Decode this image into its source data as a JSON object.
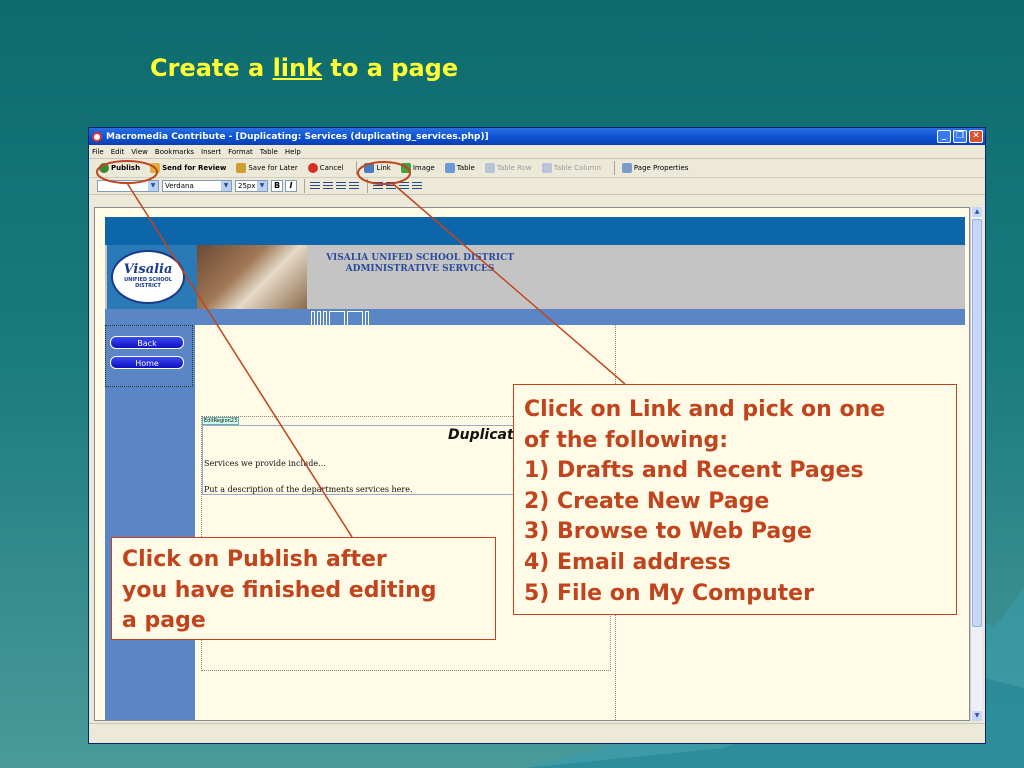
{
  "slide": {
    "title_prefix": "Create a ",
    "title_link": "link",
    "title_suffix": " to a page"
  },
  "window": {
    "title": "Macromedia Contribute - [Duplicating: Services (duplicating_services.php)]",
    "minimize": "_",
    "maximize": "❐",
    "close": "✕",
    "menu": [
      "File",
      "Edit",
      "View",
      "Bookmarks",
      "Insert",
      "Format",
      "Table",
      "Help"
    ]
  },
  "toolbar": {
    "publish": "Publish",
    "send_for_review": "Send for Review",
    "save_for_later": "Save for Later",
    "cancel": "Cancel",
    "link": "Link",
    "image": "Image",
    "table": "Table",
    "table_row": "Table Row",
    "table_column": "Table Column",
    "page_properties": "Page Properties"
  },
  "format_bar": {
    "style": "",
    "font": "Verdana",
    "size": "25px",
    "bold": "B",
    "italic": "I"
  },
  "site": {
    "logo_name": "Visalia",
    "logo_sub": "UNIFIED SCHOOL DISTRICT",
    "district_line1": "VISALIA UNIFED SCHOOL DISTRICT",
    "district_line2": "ADMINISTRATIVE SERVICES",
    "nav_back": "Back",
    "nav_home": "Home",
    "edit_region_tag": "EditRegion23",
    "page_heading": "Duplicating",
    "services_text": "Services we provide include...",
    "description_text": "Put a description of the departments services here."
  },
  "callouts": {
    "link_lines": [
      "Click on Link and pick on one",
      "of the following:",
      "1) Drafts and Recent Pages",
      "2) Create New Page",
      "3) Browse to Web Page",
      "4) Email address",
      "5) File on My Computer"
    ],
    "publish_lines": [
      "Click on Publish after",
      "you have finished editing",
      "a page"
    ]
  },
  "colors": {
    "callout": "#c0441e",
    "title": "#ffff33",
    "background": "#0d6b6e"
  }
}
